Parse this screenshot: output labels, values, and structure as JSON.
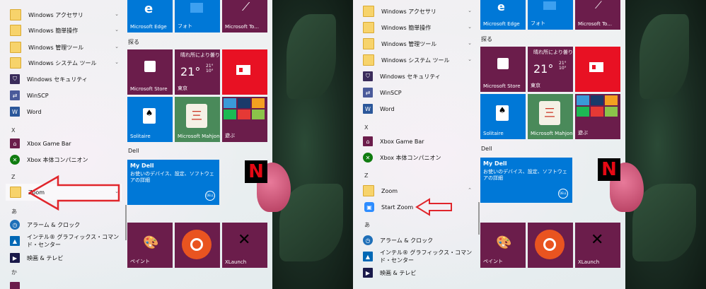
{
  "before": {
    "apps_top": [
      {
        "label": "Windows アクセサリ",
        "icon": "folder-icon",
        "chevron": "⌄"
      },
      {
        "label": "Windows 簡単操作",
        "icon": "folder-icon",
        "chevron": "⌄"
      },
      {
        "label": "Windows 管理ツール",
        "icon": "folder-icon",
        "chevron": "⌄"
      },
      {
        "label": "Windows システム ツール",
        "icon": "folder-icon",
        "chevron": "⌄"
      },
      {
        "label": "Windows セキュリティ",
        "icon": "shield-icon",
        "chevron": ""
      },
      {
        "label": "WinSCP",
        "icon": "winscp-icon",
        "chevron": ""
      },
      {
        "label": "Word",
        "icon": "word-icon",
        "chevron": ""
      }
    ],
    "letter_x": "X",
    "apps_x": [
      {
        "label": "Xbox Game Bar",
        "icon": "xbox-game-bar-icon"
      },
      {
        "label": "Xbox 本体コンパニオン",
        "icon": "xbox-icon"
      }
    ],
    "letter_z": "Z",
    "zoom": {
      "label": "Zoom",
      "chevron": "⌄"
    },
    "letter_a": "あ",
    "apps_a": [
      {
        "label": "アラーム & クロック",
        "icon": "alarm-clock-icon"
      },
      {
        "label": "インテル® グラフィックス・コマンド・センター",
        "icon": "intel-icon"
      },
      {
        "label": "映画 & テレビ",
        "icon": "movies-tv-icon"
      }
    ],
    "letter_ka": "か"
  },
  "after": {
    "zoom": {
      "label": "Zoom",
      "chevron": "⌃"
    },
    "start_zoom": "Start Zoom"
  },
  "tiles": {
    "edge": "Microsoft Edge",
    "photos": "フォト",
    "todo": "Microsoft To...",
    "explore_group": "探る",
    "store": "Microsoft Store",
    "weather": {
      "condition": "晴れ所により曇り",
      "temp": "21°",
      "hi": "21°",
      "lo": "10°",
      "city": "東京"
    },
    "solitaire": "Solitaire",
    "mahjong": "Microsoft Mahjong",
    "play": "遊ぶ",
    "dell_group": "Dell",
    "mydell": {
      "title": "My Dell",
      "desc": "お使いのデバイス、設定、ソフトウェアの詳細",
      "logo": "DELL"
    },
    "netflix": "N",
    "paint": "ペイント",
    "xlaunch": "XLaunch"
  },
  "colors": {
    "tile_purple": "#6b1d4b",
    "tile_blue": "#0078d7",
    "tile_red": "#e81123",
    "arrow_red": "#e0252b"
  }
}
